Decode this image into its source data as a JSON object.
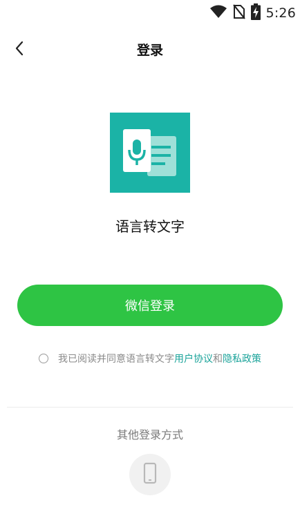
{
  "status_bar": {
    "time": "5:26",
    "icons": [
      "wifi-icon",
      "no-sim-icon",
      "battery-charging-icon"
    ]
  },
  "header": {
    "back_icon": "chevron-left-icon",
    "title": "登录"
  },
  "app": {
    "logo_icon": "voice-to-text-logo",
    "name": "语言转文字",
    "logo_color": "#1bb3a6"
  },
  "login": {
    "wechat_button": "微信登录",
    "button_color": "#2ec444"
  },
  "agreement": {
    "prefix": "我已阅读并同意语言转文字",
    "user_agreement": "用户协议",
    "and": "和",
    "privacy_policy": "隐私政策",
    "link_color": "#1aa39a"
  },
  "other_login": {
    "title": "其他登录方式",
    "phone_icon": "phone-icon"
  }
}
